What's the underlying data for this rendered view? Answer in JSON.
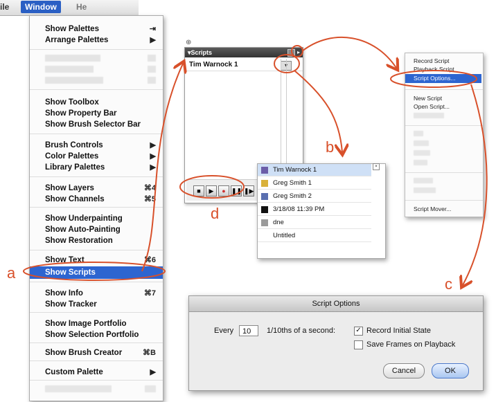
{
  "menubar": {
    "file": "ile",
    "window": "Window",
    "help": "He"
  },
  "window_menu": {
    "items": [
      {
        "label": "Show Palettes",
        "shortcut": "⇥"
      },
      {
        "label": "Arrange Palettes",
        "shortcut": "▶"
      },
      {
        "label": "",
        "shortcut": ""
      },
      {
        "label": "",
        "shortcut": ""
      },
      {
        "label": "",
        "shortcut": ""
      },
      {
        "label": "Show Toolbox",
        "shortcut": ""
      },
      {
        "label": "Show Property Bar",
        "shortcut": ""
      },
      {
        "label": "Show Brush Selector Bar",
        "shortcut": ""
      },
      {
        "label": "Brush Controls",
        "shortcut": "▶"
      },
      {
        "label": "Color Palettes",
        "shortcut": "▶"
      },
      {
        "label": "Library Palettes",
        "shortcut": "▶"
      },
      {
        "label": "Show Layers",
        "shortcut": "⌘4"
      },
      {
        "label": "Show Channels",
        "shortcut": "⌘5"
      },
      {
        "label": "Show Underpainting",
        "shortcut": ""
      },
      {
        "label": "Show Auto-Painting",
        "shortcut": ""
      },
      {
        "label": "Show Restoration",
        "shortcut": ""
      },
      {
        "label": "Show Text",
        "shortcut": "⌘6"
      },
      {
        "label": "Show Scripts",
        "shortcut": ""
      },
      {
        "label": "Show Info",
        "shortcut": "⌘7"
      },
      {
        "label": "Show Tracker",
        "shortcut": ""
      },
      {
        "label": "Show Image Portfolio",
        "shortcut": ""
      },
      {
        "label": "Show Selection Portfolio",
        "shortcut": ""
      },
      {
        "label": "Show Brush Creator",
        "shortcut": "⌘B"
      },
      {
        "label": "Custom Palette",
        "shortcut": "▶"
      },
      {
        "label": "",
        "shortcut": ""
      }
    ]
  },
  "scripts_palette": {
    "title": "Scripts",
    "current_script": "Tim Warnock 1"
  },
  "script_list": {
    "items": [
      "Tim Warnock 1",
      "Greg Smith 1",
      "Greg Smith 2",
      "3/18/08 11:39 PM",
      "dne",
      "Untitled"
    ]
  },
  "options_menu": {
    "items": [
      "Record Script",
      "Playback Script",
      "Script Options...",
      "New Script",
      "Open Script...",
      "",
      "",
      "",
      "",
      "",
      "",
      "",
      "",
      "Script Mover..."
    ]
  },
  "dialog": {
    "title": "Script Options",
    "every_label": "Every",
    "every_value": "10",
    "unit_label": "1/10ths of a second:",
    "record_initial_state": "Record Initial State",
    "save_frames": "Save Frames on Playback",
    "cancel": "Cancel",
    "ok": "OK"
  },
  "callouts": {
    "a": "a",
    "b": "b",
    "c": "c",
    "d": "d"
  },
  "colors": {
    "accent": "#2d65d0",
    "callout": "#d8502a"
  }
}
